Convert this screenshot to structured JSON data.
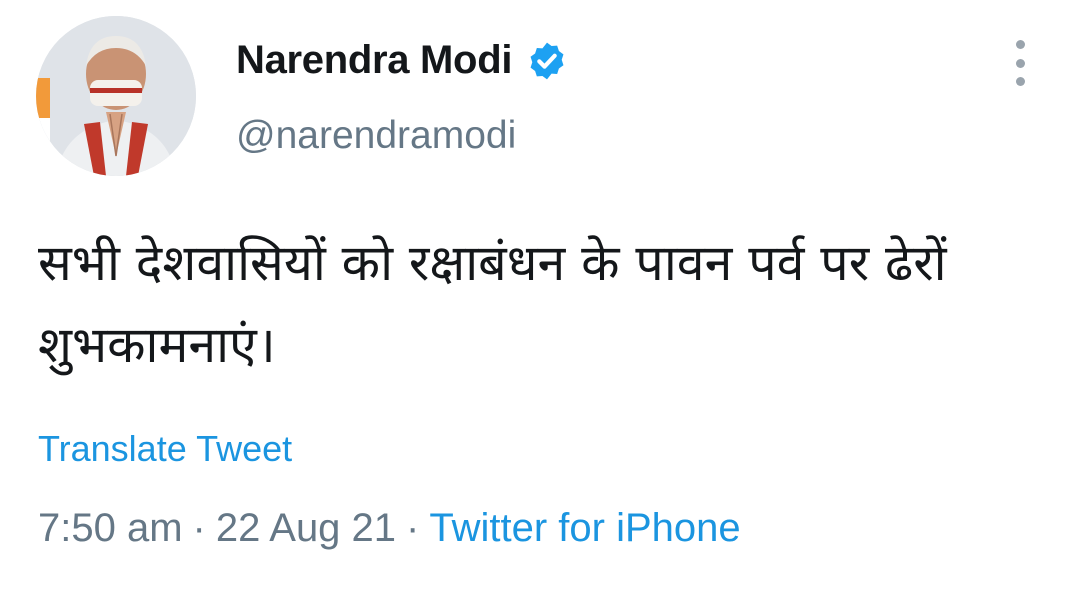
{
  "author": {
    "display_name": "Narendra Modi",
    "handle": "@narendramodi",
    "verified": true
  },
  "tweet": {
    "text": "सभी देशवासियों को रक्षाबंधन के पावन पर्व पर ढेरों शुभकामनाएं।",
    "translate_label": "Translate Tweet",
    "time": "7:50 am",
    "separator": "·",
    "date": "22 Aug 21",
    "source": "Twitter for iPhone"
  },
  "colors": {
    "accent": "#1b95e0",
    "verified_badge": "#1da1f2",
    "text_primary": "#14171a",
    "text_secondary": "#657786"
  },
  "icons": {
    "verified": "verified-badge-icon",
    "more": "more-vertical-icon"
  }
}
